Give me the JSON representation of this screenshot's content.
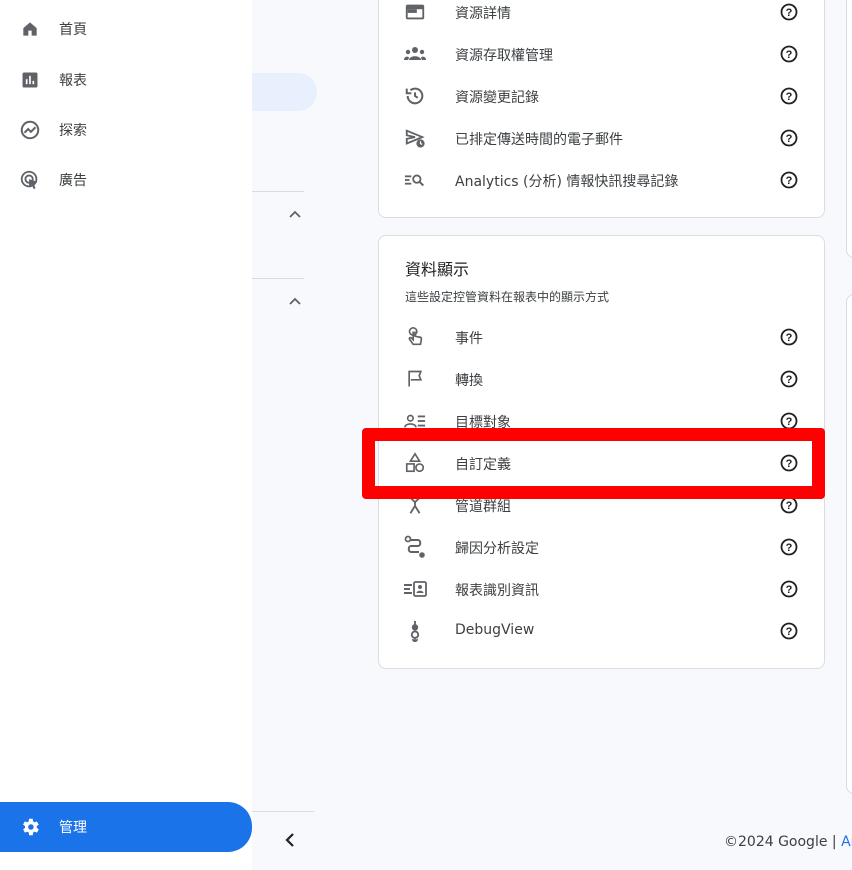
{
  "nav": {
    "items": [
      {
        "label": "首頁",
        "icon": "home-icon"
      },
      {
        "label": "報表",
        "icon": "bar-chart-icon"
      },
      {
        "label": "探索",
        "icon": "explore-icon"
      },
      {
        "label": "廣告",
        "icon": "ads-icon"
      }
    ],
    "admin": {
      "label": "管理",
      "icon": "gear-icon"
    }
  },
  "property_card": {
    "rows": [
      {
        "label": "資源詳情",
        "icon": "property-details-icon"
      },
      {
        "label": "資源存取權管理",
        "icon": "people-icon"
      },
      {
        "label": "資源變更記錄",
        "icon": "history-icon"
      },
      {
        "label": "已排定傳送時間的電子郵件",
        "icon": "scheduled-send-icon"
      },
      {
        "label": "Analytics (分析) 情報快訊搜尋記錄",
        "icon": "search-history-icon"
      }
    ]
  },
  "data_display_card": {
    "title": "資料顯示",
    "subtitle": "這些設定控管資料在報表中的顯示方式",
    "rows": [
      {
        "label": "事件",
        "icon": "touch-icon"
      },
      {
        "label": "轉換",
        "icon": "flag-icon"
      },
      {
        "label": "目標對象",
        "icon": "audience-icon"
      },
      {
        "label": "自訂定義",
        "icon": "shapes-icon"
      },
      {
        "label": "管道群組",
        "icon": "channel-icon"
      },
      {
        "label": "歸因分析設定",
        "icon": "attribution-icon"
      },
      {
        "label": "報表識別資訊",
        "icon": "reporting-identity-icon"
      },
      {
        "label": "DebugView",
        "icon": "debug-icon"
      }
    ]
  },
  "footer": {
    "copyright": "©2024 Google",
    "separator": "|",
    "link_partial": "An"
  },
  "colors": {
    "accent": "#1a73e8",
    "highlight": "#ff0000",
    "selected_bg": "#e8f0fe"
  }
}
